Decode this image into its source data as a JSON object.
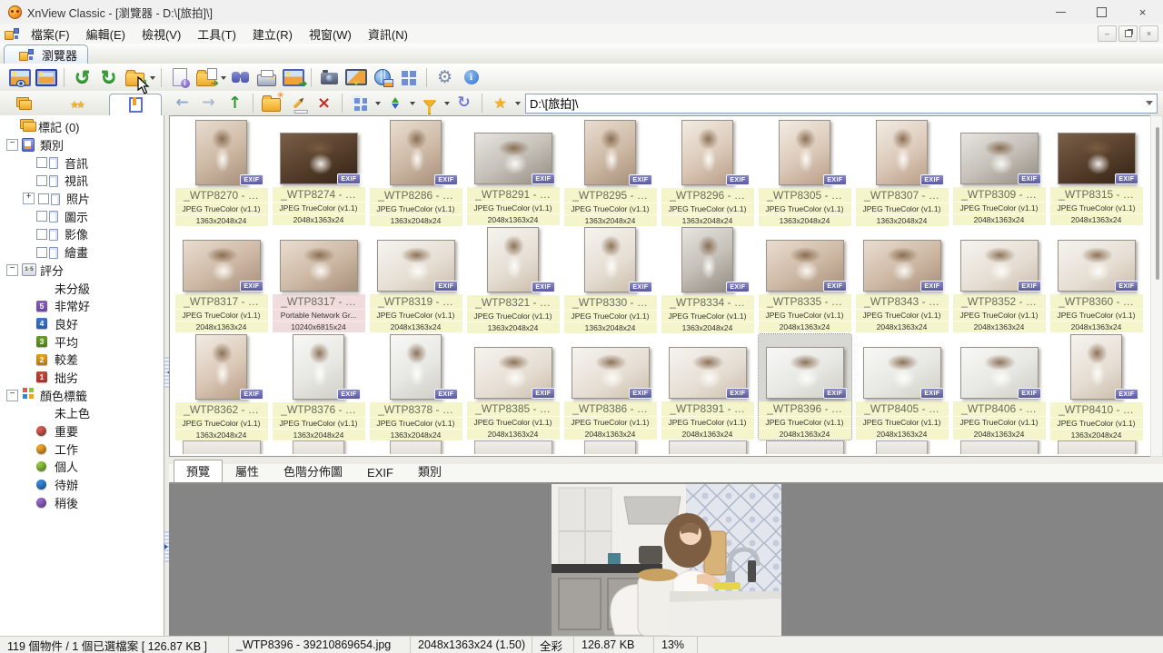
{
  "window": {
    "title": "XnView Classic - [瀏覽器 - D:\\[旅拍]\\]"
  },
  "menu": {
    "items": [
      {
        "name": "menu-file",
        "label": "檔案(F)"
      },
      {
        "name": "menu-edit",
        "label": "編輯(E)"
      },
      {
        "name": "menu-view",
        "label": "檢視(V)"
      },
      {
        "name": "menu-tools",
        "label": "工具(T)"
      },
      {
        "name": "menu-create",
        "label": "建立(R)"
      },
      {
        "name": "menu-window",
        "label": "視窗(W)"
      },
      {
        "name": "menu-info",
        "label": "資訊(N)"
      }
    ]
  },
  "browser_tab": {
    "label": "瀏覽器"
  },
  "address": {
    "value": "D:\\[旅拍]\\"
  },
  "labels": {
    "exif_badge": "EXIF"
  },
  "icons": {
    "toolbar_main": [
      "view-image-icon",
      "fullscreen-icon",
      "rotate-ccw-icon",
      "rotate-cw-icon",
      "convert-icon",
      "properties-icon",
      "open-with-icon",
      "search-icon",
      "print-icon",
      "export-icon",
      "capture-icon",
      "slideshow-icon",
      "web-icon",
      "contact-sheet-icon",
      "settings-gear-icon",
      "about-info-icon"
    ],
    "toolbar_nav": [
      "back-icon",
      "forward-icon",
      "up-icon",
      "new-folder-icon",
      "rename-icon",
      "delete-icon",
      "view-mode-icon",
      "sort-icon",
      "filter-icon",
      "refresh-icon",
      "favorites-star-icon"
    ],
    "panel_tabs": [
      "folders-icon",
      "favorites-stars-icon",
      "categories-bookmark-icon"
    ]
  },
  "sidebar": {
    "tree": [
      {
        "name": "tree-item-tags",
        "label": "標記 (0)",
        "level": "lv0",
        "icon": "ico-tags"
      },
      {
        "name": "tree-item-categories",
        "label": "類別",
        "level": "lv0",
        "icon": "ico-book",
        "expander": "expm"
      },
      {
        "name": "tree-item-cat-audio",
        "label": "音訊",
        "level": "lv1",
        "check": true
      },
      {
        "name": "tree-item-cat-video",
        "label": "視訊",
        "level": "lv1",
        "check": true
      },
      {
        "name": "tree-item-cat-photo",
        "label": "照片",
        "level": "lv1",
        "check": true,
        "expander": "expp"
      },
      {
        "name": "tree-item-cat-icon",
        "label": "圖示",
        "level": "lv1",
        "check": true
      },
      {
        "name": "tree-item-cat-image",
        "label": "影像",
        "level": "lv1",
        "check": true
      },
      {
        "name": "tree-item-cat-drawing",
        "label": "繪畫",
        "level": "lv1",
        "check": true
      },
      {
        "name": "tree-item-rating",
        "label": "評分",
        "level": "lv0",
        "icon": "ico-rating",
        "expander": "expm"
      },
      {
        "name": "tree-item-rating-none",
        "label": "未分級",
        "level": "lv1"
      },
      {
        "name": "tree-item-rating-5",
        "label": "非常好",
        "level": "lv1",
        "badge": "5",
        "badgecolor": "#8a5fc8"
      },
      {
        "name": "tree-item-rating-4",
        "label": "良好",
        "level": "lv1",
        "badge": "4",
        "badgecolor": "#3a78d0"
      },
      {
        "name": "tree-item-rating-3",
        "label": "平均",
        "level": "lv1",
        "badge": "3",
        "badgecolor": "#6ca02c"
      },
      {
        "name": "tree-item-rating-2",
        "label": "較差",
        "level": "lv1",
        "badge": "2",
        "badgecolor": "#e8a020"
      },
      {
        "name": "tree-item-rating-1",
        "label": "拙劣",
        "level": "lv1",
        "badge": "1",
        "badgecolor": "#c84838"
      },
      {
        "name": "tree-item-color-labels",
        "label": "顏色標籤",
        "level": "lv0",
        "icon": "ico-colors",
        "expander": "expm"
      },
      {
        "name": "tree-item-label-none",
        "label": "未上色",
        "level": "lv1"
      },
      {
        "name": "tree-item-label-important",
        "label": "重要",
        "level": "lv1",
        "dot": "#d85c50"
      },
      {
        "name": "tree-item-label-work",
        "label": "工作",
        "level": "lv1",
        "dot": "#f2a22a"
      },
      {
        "name": "tree-item-label-personal",
        "label": "個人",
        "level": "lv1",
        "dot": "#90c83c"
      },
      {
        "name": "tree-item-label-todo",
        "label": "待辦",
        "level": "lv1",
        "dot": "#3388dd"
      },
      {
        "name": "tree-item-label-later",
        "label": "稍後",
        "level": "lv1",
        "dot": "#9966cc"
      }
    ]
  },
  "thumbnails": {
    "items": [
      {
        "name": "thumb-wtp8270",
        "label": "_WTP8270 - …",
        "type": "JPEG TrueColor (v1.1)",
        "dims": "1363x2048x24",
        "orient": "p",
        "tone": "t1",
        "exif": true
      },
      {
        "name": "thumb-wtp8274",
        "label": "_WTP8274 - …",
        "type": "JPEG TrueColor (v1.1)",
        "dims": "2048x1363x24",
        "orient": "l",
        "tone": "t2",
        "exif": true
      },
      {
        "name": "thumb-wtp8286",
        "label": "_WTP8286 - …",
        "type": "JPEG TrueColor (v1.1)",
        "dims": "1363x2048x24",
        "orient": "p",
        "tone": "t1",
        "exif": true
      },
      {
        "name": "thumb-wtp8291",
        "label": "_WTP8291 - …",
        "type": "JPEG TrueColor (v1.1)",
        "dims": "2048x1363x24",
        "orient": "l",
        "tone": "t4",
        "exif": true
      },
      {
        "name": "thumb-wtp8295",
        "label": "_WTP8295 - …",
        "type": "JPEG TrueColor (v1.1)",
        "dims": "1363x2048x24",
        "orient": "p",
        "tone": "t1",
        "exif": true
      },
      {
        "name": "thumb-wtp8296",
        "label": "_WTP8296 - …",
        "type": "JPEG TrueColor (v1.1)",
        "dims": "1363x2048x24",
        "orient": "p",
        "tone": "t3",
        "exif": true
      },
      {
        "name": "thumb-wtp8305",
        "label": "_WTP8305 - …",
        "type": "JPEG TrueColor (v1.1)",
        "dims": "1363x2048x24",
        "orient": "p",
        "tone": "t3",
        "exif": true
      },
      {
        "name": "thumb-wtp8307",
        "label": "_WTP8307 - …",
        "type": "JPEG TrueColor (v1.1)",
        "dims": "1363x2048x24",
        "orient": "p",
        "tone": "t3",
        "exif": true
      },
      {
        "name": "thumb-wtp8309",
        "label": "_WTP8309 - …",
        "type": "JPEG TrueColor (v1.1)",
        "dims": "2048x1363x24",
        "orient": "l",
        "tone": "t4",
        "exif": true
      },
      {
        "name": "thumb-wtp8315",
        "label": "_WTP8315 - …",
        "type": "JPEG TrueColor (v1.1)",
        "dims": "2048x1363x24",
        "orient": "l",
        "tone": "t2",
        "exif": true
      },
      {
        "name": "thumb-wtp8317",
        "label": "_WTP8317 - …",
        "type": "JPEG TrueColor (v1.1)",
        "dims": "2048x1363x24",
        "orient": "l",
        "tone": "t1",
        "exif": true
      },
      {
        "name": "thumb-wtp8317-png",
        "label": "_WTP8317 - …",
        "type": "Portable Network Gr...",
        "dims": "10240x6815x24",
        "orient": "l",
        "tone": "t1",
        "kind": "png",
        "noexif": true
      },
      {
        "name": "thumb-wtp8319",
        "label": "_WTP8319 - …",
        "type": "JPEG TrueColor (v1.1)",
        "dims": "2048x1363x24",
        "orient": "l",
        "tone": "t5",
        "exif": true
      },
      {
        "name": "thumb-wtp8321",
        "label": "_WTP8321 - …",
        "type": "JPEG TrueColor (v1.1)",
        "dims": "1363x2048x24",
        "orient": "p",
        "tone": "t5",
        "exif": true
      },
      {
        "name": "thumb-wtp8330",
        "label": "_WTP8330 - …",
        "type": "JPEG TrueColor (v1.1)",
        "dims": "1363x2048x24",
        "orient": "p",
        "tone": "t5",
        "exif": true
      },
      {
        "name": "thumb-wtp8334",
        "label": "_WTP8334 - …",
        "type": "JPEG TrueColor (v1.1)",
        "dims": "1363x2048x24",
        "orient": "p",
        "tone": "t4",
        "exif": true
      },
      {
        "name": "thumb-wtp8335",
        "label": "_WTP8335 - …",
        "type": "JPEG TrueColor (v1.1)",
        "dims": "2048x1363x24",
        "orient": "l",
        "tone": "t1",
        "exif": true
      },
      {
        "name": "thumb-wtp8343",
        "label": "_WTP8343 - …",
        "type": "JPEG TrueColor (v1.1)",
        "dims": "2048x1363x24",
        "orient": "l",
        "tone": "t1",
        "exif": true
      },
      {
        "name": "thumb-wtp8352",
        "label": "_WTP8352 - …",
        "type": "JPEG TrueColor (v1.1)",
        "dims": "2048x1363x24",
        "orient": "l",
        "tone": "t5",
        "exif": true
      },
      {
        "name": "thumb-wtp8360",
        "label": "_WTP8360 - …",
        "type": "JPEG TrueColor (v1.1)",
        "dims": "2048x1363x24",
        "orient": "l",
        "tone": "t5",
        "exif": true
      },
      {
        "name": "thumb-wtp8362",
        "label": "_WTP8362 - …",
        "type": "JPEG TrueColor (v1.1)",
        "dims": "1363x2048x24",
        "orient": "p",
        "tone": "t3",
        "exif": true
      },
      {
        "name": "thumb-wtp8376",
        "label": "_WTP8376 - …",
        "type": "JPEG TrueColor (v1.1)",
        "dims": "1363x2048x24",
        "orient": "p",
        "tone": "t6",
        "exif": true
      },
      {
        "name": "thumb-wtp8378",
        "label": "_WTP8378 - …",
        "type": "JPEG TrueColor (v1.1)",
        "dims": "1363x2048x24",
        "orient": "p",
        "tone": "t6",
        "exif": true
      },
      {
        "name": "thumb-wtp8385",
        "label": "_WTP8385 - …",
        "type": "JPEG TrueColor (v1.1)",
        "dims": "2048x1363x24",
        "orient": "l",
        "tone": "t5",
        "exif": true
      },
      {
        "name": "thumb-wtp8386",
        "label": "_WTP8386 - …",
        "type": "JPEG TrueColor (v1.1)",
        "dims": "2048x1363x24",
        "orient": "l",
        "tone": "t5",
        "exif": true
      },
      {
        "name": "thumb-wtp8391",
        "label": "_WTP8391 - …",
        "type": "JPEG TrueColor (v1.1)",
        "dims": "2048x1363x24",
        "orient": "l",
        "tone": "t5",
        "exif": true
      },
      {
        "name": "thumb-wtp8396",
        "label": "_WTP8396 - …",
        "type": "JPEG TrueColor (v1.1)",
        "dims": "2048x1363x24",
        "orient": "l",
        "tone": "t6",
        "exif": true,
        "selected": true
      },
      {
        "name": "thumb-wtp8405",
        "label": "_WTP8405 - …",
        "type": "JPEG TrueColor (v1.1)",
        "dims": "2048x1363x24",
        "orient": "l",
        "tone": "t6",
        "exif": true
      },
      {
        "name": "thumb-wtp8406",
        "label": "_WTP8406 - …",
        "type": "JPEG TrueColor (v1.1)",
        "dims": "2048x1363x24",
        "orient": "l",
        "tone": "t6",
        "exif": true
      },
      {
        "name": "thumb-wtp8410",
        "label": "_WTP8410 - …",
        "type": "JPEG TrueColor (v1.1)",
        "dims": "1363x2048x24",
        "orient": "p",
        "tone": "t5",
        "exif": true
      }
    ],
    "partial_row": [
      {
        "orient": "l"
      },
      {
        "orient": "p"
      },
      {
        "orient": "p"
      },
      {
        "orient": "l"
      },
      {
        "orient": "p"
      },
      {
        "orient": "l"
      },
      {
        "orient": "l"
      },
      {
        "orient": "p"
      },
      {
        "orient": "l"
      },
      {
        "orient": "l"
      }
    ]
  },
  "bottom_tabs": {
    "items": [
      {
        "name": "tab-preview",
        "label": "預覽",
        "active": true
      },
      {
        "name": "tab-properties",
        "label": "屬性"
      },
      {
        "name": "tab-histogram",
        "label": "色階分佈圖"
      },
      {
        "name": "tab-exif",
        "label": "EXIF"
      },
      {
        "name": "tab-category",
        "label": "類別"
      }
    ]
  },
  "status": {
    "objects": "119 個物件 / 1 個已選檔案  [ 126.87 KB ]",
    "filename": "_WTP8396 - 39210869654.jpg",
    "dimensions": "2048x1363x24 (1.50)",
    "color_mode": "全彩",
    "file_size": "126.87 KB",
    "zoom": "13%"
  }
}
